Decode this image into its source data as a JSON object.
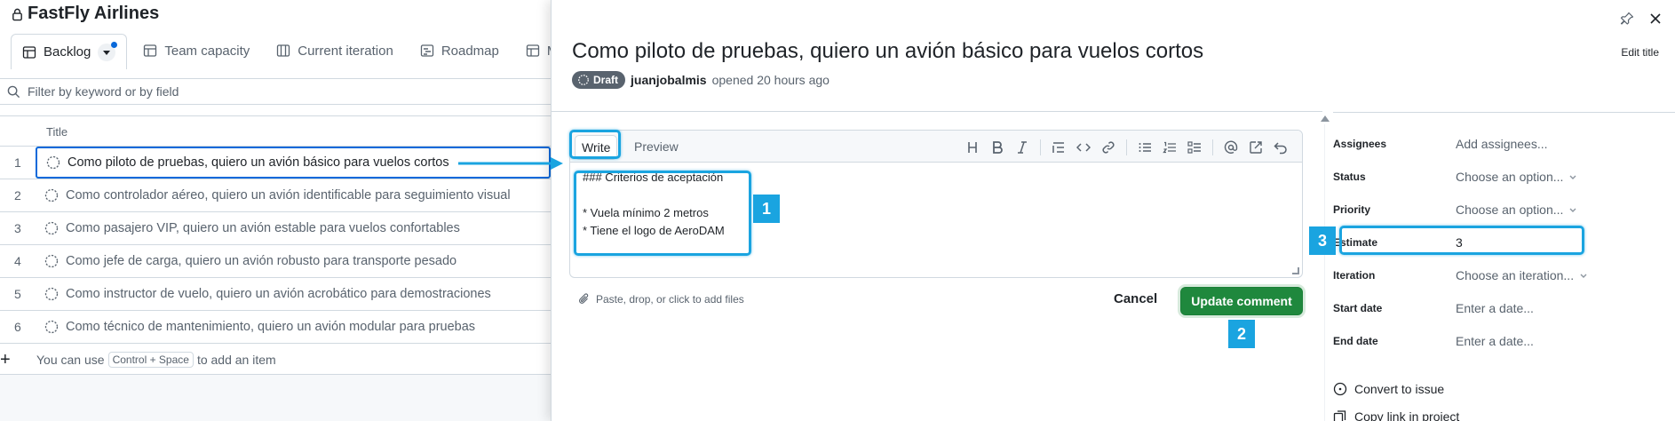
{
  "project": {
    "title": "FastFly Airlines"
  },
  "tabs": [
    {
      "label": "Backlog",
      "active": true
    },
    {
      "label": "Team capacity"
    },
    {
      "label": "Current iteration"
    },
    {
      "label": "Roadmap"
    },
    {
      "label": "M"
    }
  ],
  "filter": {
    "placeholder": "Filter by keyword or by field"
  },
  "table": {
    "column_title": "Title",
    "rows": [
      {
        "num": "1",
        "title": "Como piloto de pruebas, quiero un avión básico para vuelos cortos"
      },
      {
        "num": "2",
        "title": "Como controlador aéreo, quiero un avión identificable para seguimiento visual"
      },
      {
        "num": "3",
        "title": "Como pasajero VIP, quiero un avión estable para vuelos confortables"
      },
      {
        "num": "4",
        "title": "Como jefe de carga, quiero un avión robusto para transporte pesado"
      },
      {
        "num": "5",
        "title": "Como instructor de vuelo, quiero un avión acrobático para demostraciones"
      },
      {
        "num": "6",
        "title": "Como técnico de mantenimiento, quiero un avión modular para pruebas"
      }
    ],
    "add_hint_prefix": "You can use",
    "add_hint_key": "Control + Space",
    "add_hint_suffix": "to add an item"
  },
  "issue": {
    "title": "Como piloto de pruebas, quiero un avión básico para vuelos cortos",
    "edit_title": "Edit title",
    "status_badge": "Draft",
    "author": "juanjobalmis",
    "opened": "opened 20 hours ago"
  },
  "editor": {
    "write_tab": "Write",
    "preview_tab": "Preview",
    "content": "### Criterios de aceptación\n\n* Vuela mínimo 2 metros\n* Tiene el logo de AeroDAM",
    "attach_hint": "Paste, drop, or click to add files",
    "cancel_label": "Cancel",
    "update_label": "Update comment"
  },
  "fields": [
    {
      "label": "Assignees",
      "value": "Add assignees..."
    },
    {
      "label": "Status",
      "value": "Choose an option..."
    },
    {
      "label": "Priority",
      "value": "Choose an option..."
    },
    {
      "label": "Estimate",
      "value": "3"
    },
    {
      "label": "Iteration",
      "value": "Choose an iteration..."
    },
    {
      "label": "Start date",
      "value": "Enter a date..."
    },
    {
      "label": "End date",
      "value": "Enter a date..."
    }
  ],
  "actions": {
    "convert": "Convert to issue",
    "copy_link": "Copy link in project"
  },
  "callouts": [
    "1",
    "2",
    "3"
  ],
  "colors": {
    "accent": "#1aa4e0",
    "primary_button": "#1f883d",
    "link": "#0969da"
  }
}
